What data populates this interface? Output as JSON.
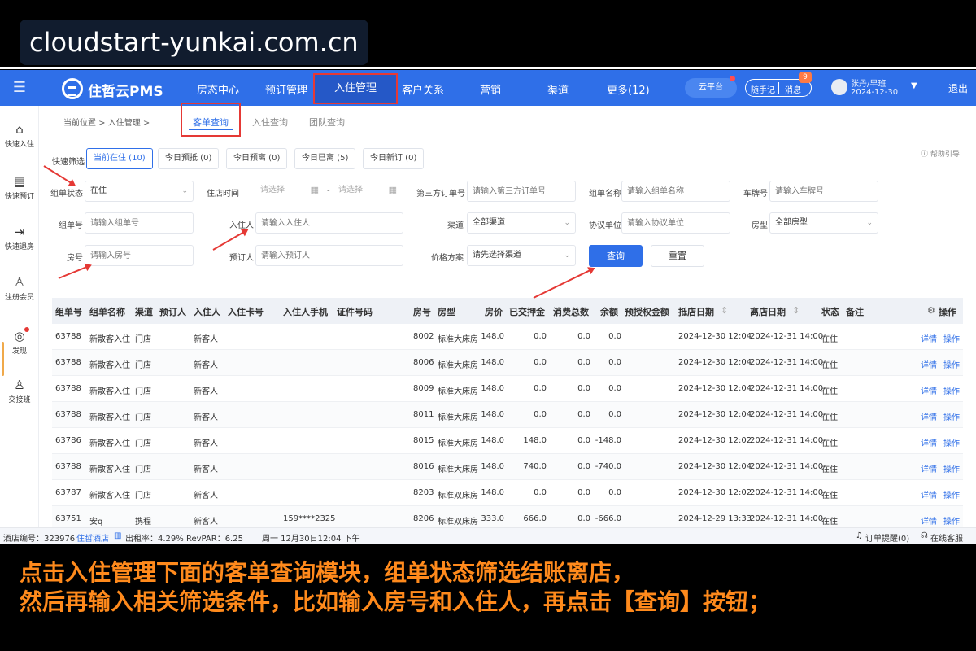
{
  "overlay_url": "cloudstart-yunkai.com.cn",
  "topnav": {
    "brand": "住哲云PMS",
    "items": [
      "房态中心",
      "预订管理",
      "入住管理",
      "客户关系",
      "营销",
      "渠道",
      "更多(12)"
    ],
    "active_index": 2,
    "cloud_label": "云平台",
    "pill_left": "随手记",
    "pill_right": "消息",
    "badge": "9",
    "user_name": "张丹/早班",
    "user_date": "2024-12-30",
    "logout": "退出"
  },
  "sidebar": [
    "快速入住",
    "快速预订",
    "快速退房",
    "注册会员",
    "发现",
    "交接班"
  ],
  "breadcrumb": "当前位置 > 入住管理 >",
  "content_tabs": [
    "客单查询",
    "入住查询",
    "团队查询"
  ],
  "quick_filter": {
    "label": "快速筛选",
    "buttons": [
      "当前在住 (10)",
      "今日预抵 (0)",
      "今日预离 (0)",
      "今日已离 (5)",
      "今日新订 (0)"
    ],
    "help": "帮助引导"
  },
  "form": {
    "group_status": {
      "label": "组单状态",
      "value": "在住"
    },
    "checkin_time": {
      "label": "住店时间",
      "from": "请选择",
      "to": "请选择",
      "dash": "-"
    },
    "third_order": {
      "label": "第三方订单号",
      "placeholder": "请输入第三方订单号"
    },
    "group_name": {
      "label": "组单名称",
      "placeholder": "请输入组单名称"
    },
    "plate": {
      "label": "车牌号",
      "placeholder": "请输入车牌号"
    },
    "group_no": {
      "label": "组单号",
      "placeholder": "请输入组单号"
    },
    "guest": {
      "label": "入住人",
      "placeholder": "请输入入住人"
    },
    "channel": {
      "label": "渠道",
      "value": "全部渠道"
    },
    "agreement": {
      "label": "协议单位",
      "placeholder": "请输入协议单位"
    },
    "room_type": {
      "label": "房型",
      "value": "全部房型"
    },
    "room_no": {
      "label": "房号",
      "placeholder": "请输入房号"
    },
    "booker": {
      "label": "预订人",
      "placeholder": "请输入预订人"
    },
    "price_plan": {
      "label": "价格方案",
      "value": "请先选择渠道"
    },
    "query": "查询",
    "reset": "重置"
  },
  "table": {
    "headers": [
      "组单号",
      "组单名称",
      "渠道",
      "预订人",
      "入住人",
      "入住卡号",
      "入住人手机",
      "证件号码",
      "房号",
      "房型",
      "房价",
      "已交押金",
      "消费总数",
      "余额",
      "预授权金额",
      "抵店日期",
      "离店日期",
      "状态",
      "备注",
      "操作"
    ],
    "rows": [
      [
        "63788",
        "新散客入住",
        "门店",
        "",
        "新客人",
        "",
        "",
        "",
        "8002",
        "标准大床房",
        "148.0",
        "0.0",
        "0.0",
        "0.0",
        "",
        "2024-12-30 12:04",
        "2024-12-31 14:00",
        "在住",
        "",
        "详情",
        "操作"
      ],
      [
        "63788",
        "新散客入住",
        "门店",
        "",
        "新客人",
        "",
        "",
        "",
        "8006",
        "标准大床房",
        "148.0",
        "0.0",
        "0.0",
        "0.0",
        "",
        "2024-12-30 12:04",
        "2024-12-31 14:00",
        "在住",
        "",
        "详情",
        "操作"
      ],
      [
        "63788",
        "新散客入住",
        "门店",
        "",
        "新客人",
        "",
        "",
        "",
        "8009",
        "标准大床房",
        "148.0",
        "0.0",
        "0.0",
        "0.0",
        "",
        "2024-12-30 12:04",
        "2024-12-31 14:00",
        "在住",
        "",
        "详情",
        "操作"
      ],
      [
        "63788",
        "新散客入住",
        "门店",
        "",
        "新客人",
        "",
        "",
        "",
        "8011",
        "标准大床房",
        "148.0",
        "0.0",
        "0.0",
        "0.0",
        "",
        "2024-12-30 12:04",
        "2024-12-31 14:00",
        "在住",
        "",
        "详情",
        "操作"
      ],
      [
        "63786",
        "新散客入住",
        "门店",
        "",
        "新客人",
        "",
        "",
        "",
        "8015",
        "标准大床房",
        "148.0",
        "148.0",
        "0.0",
        "-148.0",
        "",
        "2024-12-30 12:02",
        "2024-12-31 14:00",
        "在住",
        "",
        "详情",
        "操作"
      ],
      [
        "63788",
        "新散客入住",
        "门店",
        "",
        "新客人",
        "",
        "",
        "",
        "8016",
        "标准大床房",
        "148.0",
        "740.0",
        "0.0",
        "-740.0",
        "",
        "2024-12-30 12:04",
        "2024-12-31 14:00",
        "在住",
        "",
        "详情",
        "操作"
      ],
      [
        "63787",
        "新散客入住",
        "门店",
        "",
        "新客人",
        "",
        "",
        "",
        "8203",
        "标准双床房",
        "148.0",
        "0.0",
        "0.0",
        "0.0",
        "",
        "2024-12-30 12:02",
        "2024-12-31 14:00",
        "在住",
        "",
        "详情",
        "操作"
      ],
      [
        "63751",
        "安q",
        "携程",
        "",
        "新客人",
        "",
        "159****2325",
        "",
        "8206",
        "标准双床房",
        "333.0",
        "666.0",
        "0.0",
        "-666.0",
        "",
        "2024-12-29 13:33",
        "2024-12-31 14:00",
        "在住",
        "",
        "详情",
        "操作"
      ]
    ]
  },
  "statusbar": {
    "hotel": "酒店编号：323976",
    "hotel_name": "住哲酒店",
    "occupancy": "出租率：4.29% RevPAR：6.25",
    "time": "周一 12月30日12:04 下午",
    "reminder": "订单提醒(0)",
    "service": "在线客服"
  },
  "caption": [
    "点击入住管理下面的客单查询模块，组单状态筛选结账离店，",
    "然后再输入相关筛选条件，比如输入房号和入住人，再点击【查询】按钮；"
  ],
  "colors": {
    "primary": "#2f6fe8",
    "highlight": "#e53935",
    "caption": "#ff8a1c"
  }
}
